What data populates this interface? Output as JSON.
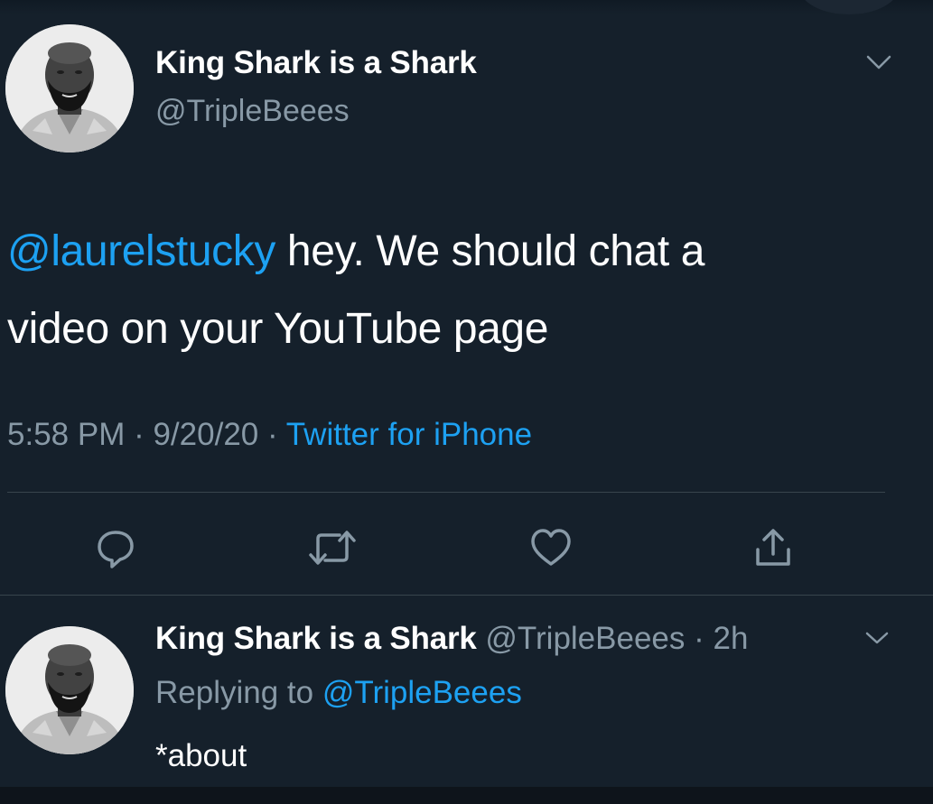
{
  "tweet": {
    "author": {
      "name": "King Shark is a Shark",
      "handle": "@TripleBeees",
      "avatar": "profile-photo"
    },
    "text": {
      "mention": "@laurelstucky",
      "line1_rest": " hey. We should chat a",
      "line2": "video on your YouTube page"
    },
    "meta": {
      "time": "5:58 PM",
      "sep1": " · ",
      "date": "9/20/20",
      "sep2": " · ",
      "source": "Twitter for iPhone"
    },
    "actions": [
      {
        "name": "reply",
        "icon": "comment-bubble-icon"
      },
      {
        "name": "retweet",
        "icon": "retweet-arrows-icon"
      },
      {
        "name": "like",
        "icon": "heart-icon"
      },
      {
        "name": "share",
        "icon": "share-upload-icon"
      }
    ],
    "menu_icon": "chevron-down-icon"
  },
  "reply": {
    "author": {
      "name": "King Shark is a Shark",
      "handle": " @TripleBeees",
      "time": " · 2h",
      "avatar": "profile-photo"
    },
    "replying_prefix": "Replying to ",
    "replying_to": "@TripleBeees",
    "text": "*about",
    "menu_icon": "chevron-down-icon"
  },
  "colors": {
    "background": "#15202b",
    "text_primary": "#ffffff",
    "text_secondary": "#8899a6",
    "accent": "#1da1f2",
    "divider": "#38444d"
  }
}
